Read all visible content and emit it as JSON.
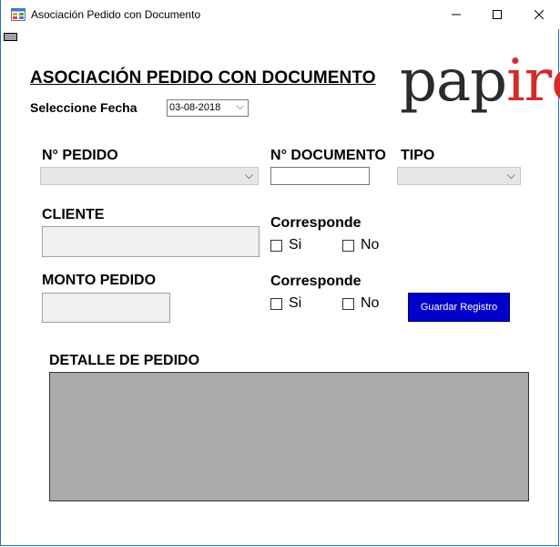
{
  "window": {
    "title": "Asociación Pedido con Documento",
    "controls": {
      "minimize": "—",
      "maximize": "☐",
      "close": "✕"
    }
  },
  "header": {
    "heading": "ASOCIACIÓN PEDIDO CON DOCUMENTO",
    "logo_part1": "pap",
    "logo_part2": "iro",
    "logo_colors": {
      "dark": "#2b2b2b",
      "red": "#d42b2b"
    }
  },
  "date": {
    "label": "Seleccione Fecha",
    "value": "03-08-2018"
  },
  "pedido": {
    "label": "N° PEDIDO",
    "value": ""
  },
  "documento": {
    "label": "N° DOCUMENTO",
    "value": ""
  },
  "tipo": {
    "label": "TIPO",
    "value": ""
  },
  "cliente": {
    "label": "CLIENTE",
    "value": ""
  },
  "corresponde_cliente": {
    "label": "Corresponde",
    "si": "Si",
    "no": "No"
  },
  "monto": {
    "label": "MONTO PEDIDO",
    "value": ""
  },
  "corresponde_monto": {
    "label": "Corresponde",
    "si": "Si",
    "no": "No"
  },
  "actions": {
    "save_label": "Guardar Registro",
    "save_color": "#0000c8"
  },
  "detalle": {
    "label": "DETALLE DE PEDIDO"
  }
}
